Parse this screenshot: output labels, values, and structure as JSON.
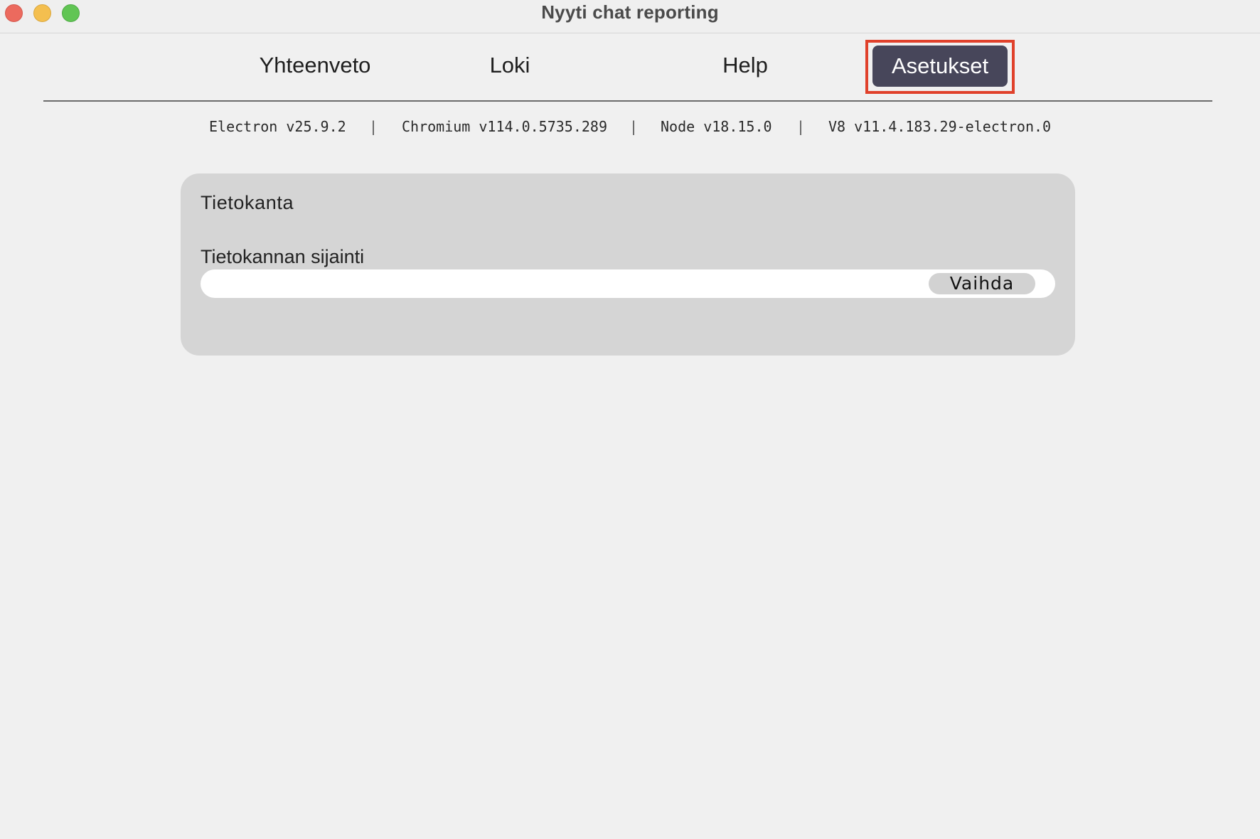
{
  "window": {
    "title": "Nyyti chat reporting"
  },
  "nav": {
    "tabs": [
      {
        "label": "Yhteenveto",
        "active": false
      },
      {
        "label": "Loki",
        "active": false
      },
      {
        "label": "Help",
        "active": false
      },
      {
        "label": "Asetukset",
        "active": true
      }
    ],
    "active_color": "#47465a",
    "highlight_color": "#e0412b"
  },
  "versions": {
    "electron": "Electron v25.9.2",
    "chromium": "Chromium v114.0.5735.289",
    "node": "Node v18.15.0",
    "v8": "V8 v11.4.183.29-electron.0",
    "separator": "|"
  },
  "settings": {
    "section_title": "Tietokanta",
    "db_location_label": "Tietokannan sijainti",
    "db_location_value": "",
    "change_button_label": "Vaihda"
  }
}
